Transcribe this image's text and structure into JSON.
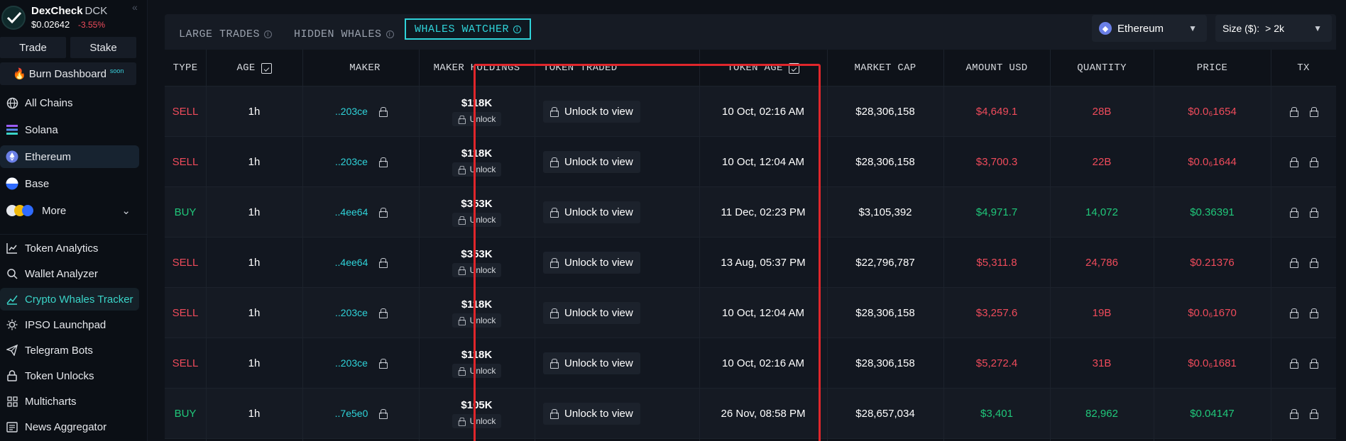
{
  "brand": {
    "name": "DexCheck",
    "ticker": "DCK",
    "price": "$0.02642",
    "change": "-3.55%"
  },
  "sidebar": {
    "trade_label": "Trade",
    "stake_label": "Stake",
    "burn_label": "Burn Dashboard",
    "burn_badge": "soon",
    "chains": [
      {
        "label": "All Chains"
      },
      {
        "label": "Solana"
      },
      {
        "label": "Ethereum"
      },
      {
        "label": "Base"
      },
      {
        "label": "More"
      }
    ],
    "tools": [
      {
        "label": "Token Analytics"
      },
      {
        "label": "Wallet Analyzer"
      },
      {
        "label": "Crypto Whales Tracker"
      },
      {
        "label": "IPSO Launchpad"
      },
      {
        "label": "Telegram Bots"
      },
      {
        "label": "Token Unlocks"
      },
      {
        "label": "Multicharts"
      },
      {
        "label": "News Aggregator"
      }
    ]
  },
  "tabs": [
    {
      "label": "LARGE TRADES"
    },
    {
      "label": "HIDDEN WHALES"
    },
    {
      "label": "WHALES WATCHER"
    }
  ],
  "filters": {
    "chain": "Ethereum",
    "size_label": "Size ($):",
    "size_value": "> 2k"
  },
  "columns": {
    "type": "TYPE",
    "age": "AGE",
    "maker": "MAKER",
    "holdings": "MAKER HOLDINGS",
    "token": "TOKEN TRADED",
    "token_age": "TOKEN AGE",
    "mcap": "MARKET CAP",
    "amount": "AMOUNT USD",
    "quantity": "QUANTITY",
    "price": "PRICE",
    "tx": "TX"
  },
  "unlock_label": "Unlock",
  "unlock_view_label": "Unlock to view",
  "rows": [
    {
      "type": "SELL",
      "age": "1h",
      "maker": "..203ce",
      "holdings": "$118K",
      "token_age": "10 Oct, 02:16 AM",
      "mcap": "$28,306,158",
      "amount": "$4,649.1",
      "quantity": "28B",
      "price": "$0.0₆1654"
    },
    {
      "type": "SELL",
      "age": "1h",
      "maker": "..203ce",
      "holdings": "$118K",
      "token_age": "10 Oct, 12:04 AM",
      "mcap": "$28,306,158",
      "amount": "$3,700.3",
      "quantity": "22B",
      "price": "$0.0₆1644"
    },
    {
      "type": "BUY",
      "age": "1h",
      "maker": "..4ee64",
      "holdings": "$353K",
      "token_age": "11 Dec, 02:23 PM",
      "mcap": "$3,105,392",
      "amount": "$4,971.7",
      "quantity": "14,072",
      "price": "$0.36391"
    },
    {
      "type": "SELL",
      "age": "1h",
      "maker": "..4ee64",
      "holdings": "$353K",
      "token_age": "13 Aug, 05:37 PM",
      "mcap": "$22,796,787",
      "amount": "$5,311.8",
      "quantity": "24,786",
      "price": "$0.21376"
    },
    {
      "type": "SELL",
      "age": "1h",
      "maker": "..203ce",
      "holdings": "$118K",
      "token_age": "10 Oct, 12:04 AM",
      "mcap": "$28,306,158",
      "amount": "$3,257.6",
      "quantity": "19B",
      "price": "$0.0₆1670"
    },
    {
      "type": "SELL",
      "age": "1h",
      "maker": "..203ce",
      "holdings": "$118K",
      "token_age": "10 Oct, 02:16 AM",
      "mcap": "$28,306,158",
      "amount": "$5,272.4",
      "quantity": "31B",
      "price": "$0.0₆1681"
    },
    {
      "type": "BUY",
      "age": "1h",
      "maker": "..7e5e0",
      "holdings": "$105K",
      "token_age": "26 Nov, 08:58 PM",
      "mcap": "$28,657,034",
      "amount": "$3,401",
      "quantity": "82,962",
      "price": "$0.04147"
    }
  ],
  "colors": {
    "accent": "#2fd3d9",
    "sell": "#ef4b5b",
    "buy": "#20c77a",
    "highlight": "#e0262b"
  }
}
